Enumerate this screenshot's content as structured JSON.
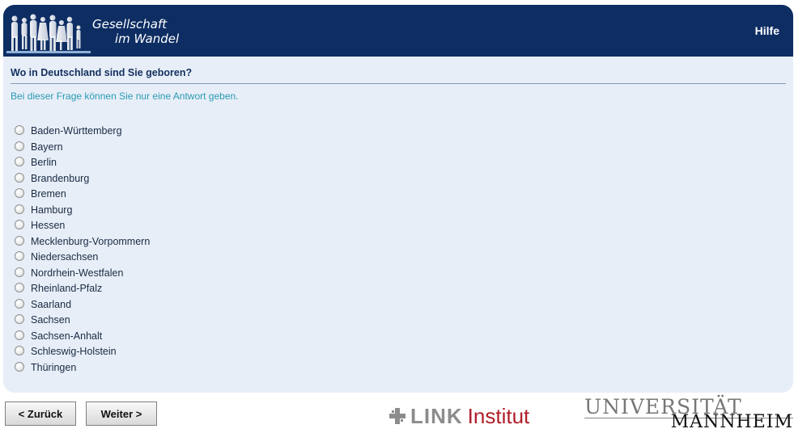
{
  "header": {
    "logo_line1": "Gesellschaft",
    "logo_line2": "im Wandel",
    "help_label": "Hilfe",
    "colors": {
      "bar": "#0d2d63",
      "panel": "#e7eef7"
    }
  },
  "question": {
    "title": "Wo in Deutschland sind Sie geboren?",
    "instruction": "Bei dieser Frage können Sie nur eine Antwort geben.",
    "options": [
      "Baden-Württemberg",
      "Bayern",
      "Berlin",
      "Brandenburg",
      "Bremen",
      "Hamburg",
      "Hessen",
      "Mecklenburg-Vorpommern",
      "Niedersachsen",
      "Nordrhein-Westfalen",
      "Rheinland-Pfalz",
      "Saarland",
      "Sachsen",
      "Sachsen-Anhalt",
      "Schleswig-Holstein",
      "Thüringen"
    ],
    "selected": null
  },
  "footer": {
    "back_label": "< Zurück",
    "next_label": "Weiter >",
    "link_word": "LINK",
    "link_institut": "Institut",
    "uni_line1": "UNIVERSITÄT",
    "uni_line2": "MANNHEIM"
  }
}
